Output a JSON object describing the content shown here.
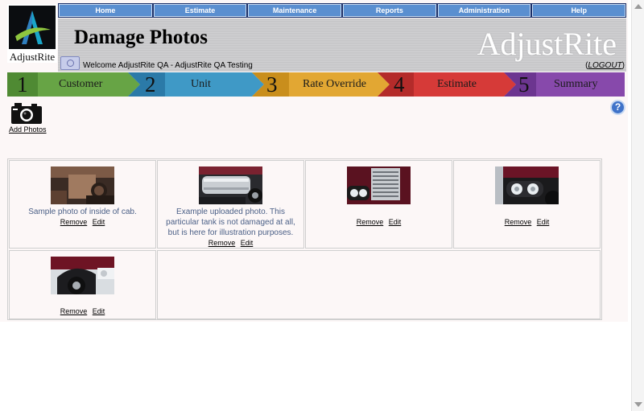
{
  "logo": {
    "name": "AdjustRite"
  },
  "menu": [
    "Home",
    "Estimate",
    "Maintenance",
    "Reports",
    "Administration",
    "Help"
  ],
  "header": {
    "title": "Damage Photos",
    "brand": "AdjustRite",
    "welcome": "Welcome AdjustRite QA - AdjustRite QA Testing",
    "logout_open": "(",
    "logout_label": "LOGOUT",
    "logout_close": ")"
  },
  "steps": [
    {
      "num": "1",
      "label": "Customer",
      "color": "#67a445"
    },
    {
      "num": "2",
      "label": "Unit",
      "color": "#3f99c6"
    },
    {
      "num": "3",
      "label": "Rate Override",
      "color": "#e2a733"
    },
    {
      "num": "4",
      "label": "Estimate",
      "color": "#d63a38"
    },
    {
      "num": "5",
      "label": "Summary",
      "color": "#8749ab"
    }
  ],
  "actions": {
    "add_photos": "Add Photos",
    "help": "?"
  },
  "photos": [
    {
      "caption": "Sample photo of inside of cab.",
      "remove": "Remove",
      "edit": "Edit",
      "subject": "truck cab interior"
    },
    {
      "caption": "Example uploaded photo. This particular tank is not damaged at all, but is here for illustration purposes.",
      "remove": "Remove",
      "edit": "Edit",
      "subject": "truck fuel tank"
    },
    {
      "caption": "",
      "remove": "Remove",
      "edit": "Edit",
      "subject": "truck grille and headlight"
    },
    {
      "caption": "",
      "remove": "Remove",
      "edit": "Edit",
      "subject": "truck headlights"
    },
    {
      "caption": "",
      "remove": "Remove",
      "edit": "Edit",
      "subject": "truck front wheel"
    }
  ]
}
